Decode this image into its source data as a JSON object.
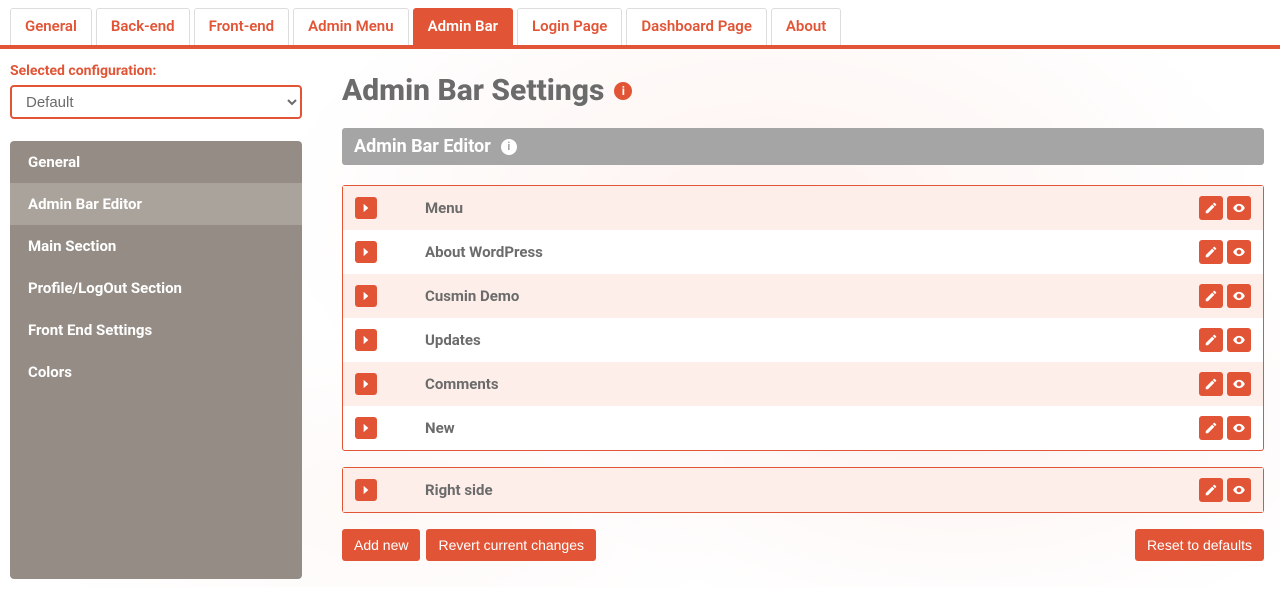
{
  "tabs": [
    {
      "label": "General"
    },
    {
      "label": "Back-end"
    },
    {
      "label": "Front-end"
    },
    {
      "label": "Admin Menu"
    },
    {
      "label": "Admin Bar",
      "active": true
    },
    {
      "label": "Login Page"
    },
    {
      "label": "Dashboard Page"
    },
    {
      "label": "About"
    }
  ],
  "selected_config": {
    "label": "Selected configuration:",
    "value": "Default"
  },
  "sidebar": {
    "items": [
      {
        "label": "General"
      },
      {
        "label": "Admin Bar Editor",
        "active": true
      },
      {
        "label": "Main Section"
      },
      {
        "label": "Profile/LogOut Section"
      },
      {
        "label": "Front End Settings"
      },
      {
        "label": "Colors"
      }
    ]
  },
  "page": {
    "title": "Admin Bar Settings"
  },
  "section": {
    "title": "Admin Bar Editor"
  },
  "group1": {
    "items": [
      {
        "label": "Menu"
      },
      {
        "label": "About WordPress"
      },
      {
        "label": "Cusmin Demo"
      },
      {
        "label": "Updates"
      },
      {
        "label": "Comments"
      },
      {
        "label": "New"
      }
    ]
  },
  "group2": {
    "items": [
      {
        "label": "Right side"
      }
    ]
  },
  "buttons": {
    "add_new": "Add new",
    "revert": "Revert current changes",
    "reset": "Reset to defaults"
  }
}
